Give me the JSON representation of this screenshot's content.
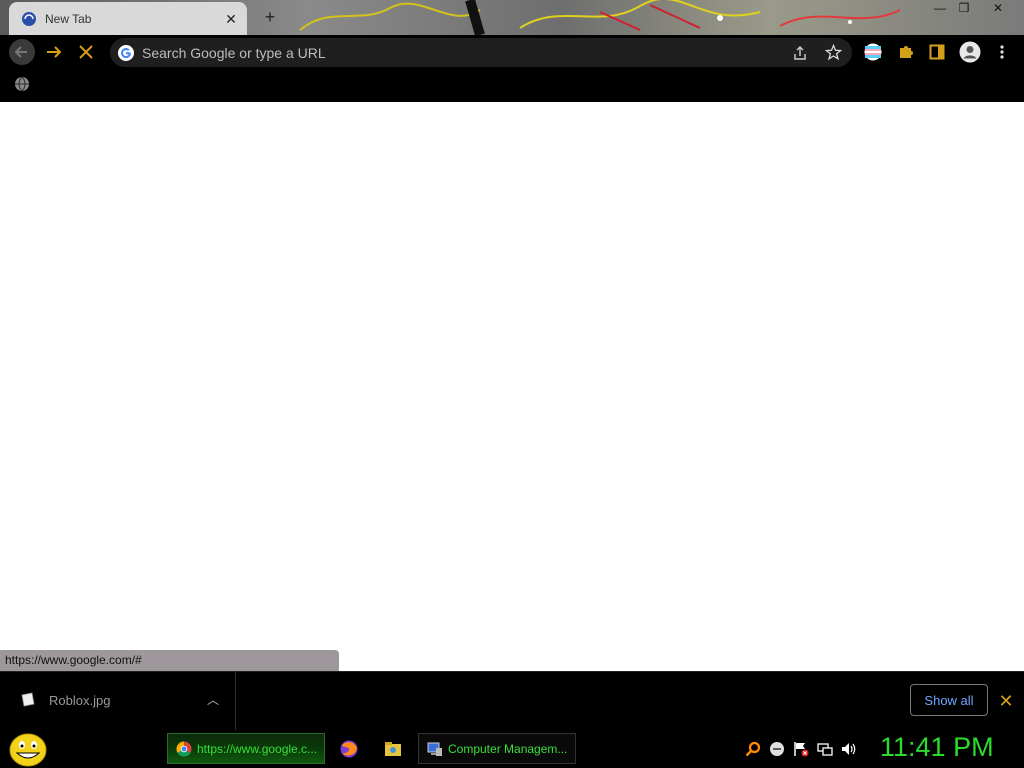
{
  "tab": {
    "title": "New Tab"
  },
  "window": {
    "minimize": "—",
    "restore": "❐",
    "close": "✕"
  },
  "omnibox": {
    "placeholder": "Search Google or type a URL"
  },
  "status_url": "https://www.google.com/#",
  "downloads": {
    "file_name": "Roblox.jpg",
    "show_all_label": "Show all"
  },
  "taskbar": {
    "items": [
      {
        "label": "https://www.google.c..."
      },
      {
        "label": "Computer Managem..."
      }
    ],
    "clock": "11:41 PM"
  },
  "colors": {
    "accent_green": "#2bdc2b",
    "link_blue": "#6ea8ff",
    "close_gold": "#d4a017"
  }
}
